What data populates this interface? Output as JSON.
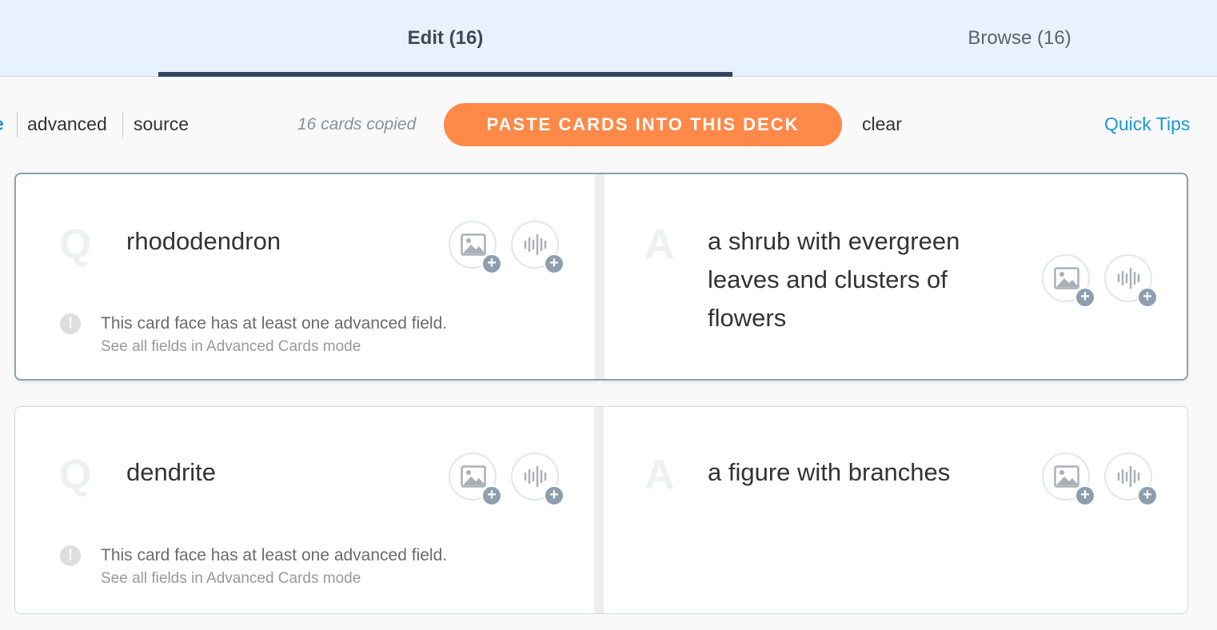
{
  "tabs": {
    "edit_label": "Edit (16)",
    "browse_label": "Browse (16)"
  },
  "toolbar": {
    "mode_cut": "e",
    "mode_advanced": "advanced",
    "mode_source": "source",
    "copied_text": "16 cards copied",
    "paste_label": "PASTE CARDS INTO THIS DECK",
    "clear_label": "clear",
    "quick_tips_label": "Quick Tips"
  },
  "cards": [
    {
      "q_letter": "Q",
      "a_letter": "A",
      "question": "rhododendron",
      "answer_lines": [
        "a shrub with evergreen",
        "leaves and clusters of",
        "flowers"
      ],
      "warning": "This card face has at least one advanced field.",
      "warning_sub": "See all fields in Advanced Cards mode"
    },
    {
      "q_letter": "Q",
      "a_letter": "A",
      "question": "dendrite",
      "answer_lines": [
        "a figure with branches"
      ],
      "warning": "This card face has at least one advanced field.",
      "warning_sub": "See all fields in Advanced Cards mode"
    }
  ],
  "icons": {
    "image": "image-add-icon",
    "audio": "audio-add-icon",
    "plus_glyph": "+",
    "warning_glyph": "!"
  },
  "colors": {
    "tab_bg": "#e8f2fc",
    "active_tab_bar": "#2f4560",
    "accent_orange": "#ff8948",
    "link_blue": "#1a97d6"
  }
}
